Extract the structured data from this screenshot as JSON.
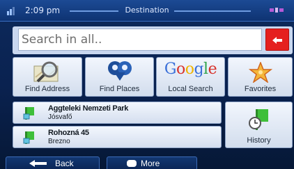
{
  "status": {
    "time": "2:09 pm",
    "title": "Destination",
    "icons": [
      "signal-icon",
      "satellite-icon"
    ]
  },
  "search": {
    "placeholder": "Search in all..",
    "back_icon": "red-back-arrow-icon"
  },
  "tiles": [
    {
      "label": "Find Address",
      "icon": "map-magnifier-icon"
    },
    {
      "label": "Find Places",
      "icon": "poi-pins-icon"
    },
    {
      "label": "Local Search",
      "icon": "google-logo",
      "logo_text": "Google"
    },
    {
      "label": "Favorites",
      "icon": "star-icon"
    }
  ],
  "recent": [
    {
      "name": "Aggteleki Nemzeti Park",
      "sub": "Jósvafő",
      "icon": "recent-flag-icon"
    },
    {
      "name": "Rohozná 45",
      "sub": "Brezno",
      "icon": "recent-flag-icon"
    }
  ],
  "history": {
    "label": "History",
    "icon": "history-flag-clock-icon"
  },
  "bottom": {
    "back_label": "Back",
    "more_label": "More"
  },
  "colors": {
    "background": "#0b2452",
    "status_bar": "#1c4a94",
    "tile": "#e6edf8",
    "accent_red": "#e5201f",
    "flag_green": "#3fbf3a"
  }
}
